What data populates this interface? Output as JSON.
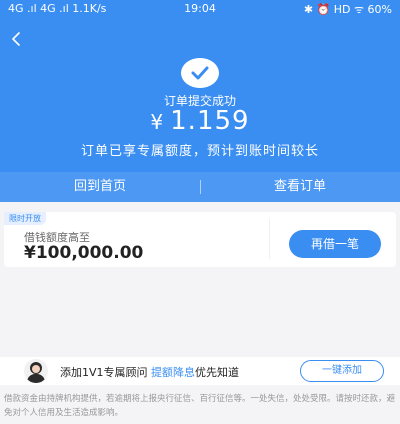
{
  "status_bar": {
    "left": "4G .ıl 4G .ıl 1.1K/s",
    "time": "19:04",
    "right": "✱ ⏰ HD ᯤ 60%"
  },
  "result": {
    "title": "订单提交成功",
    "currency": "¥",
    "amount": "1.159",
    "note": "订单已享专属额度，预计到账时间较长"
  },
  "actions": {
    "home_label": "回到首页",
    "order_label": "查看订单"
  },
  "loan_card": {
    "tag": "限时开放",
    "label": "借钱额度高至",
    "value": "¥100,000.00",
    "button_label": "再借一笔"
  },
  "advisor": {
    "text_before": "添加1V1专属顾问 ",
    "highlight": "提额降息",
    "text_after": "优先知道",
    "button_label": "一键添加"
  },
  "disclaimer": "借款资金由持牌机构提供，若逾期将上报央行征信、百行征信等。一处失信，处处受限。请按时还款，避免对个人信用及生活造成影响。",
  "colors": {
    "accent": "#3a8ef2",
    "hero_background": "#3a8ef2",
    "page_background": "#f4f4f6"
  },
  "icons": [
    "back-arrow-icon",
    "checkmark-icon",
    "signal-icon",
    "wifi-icon",
    "battery-icon",
    "advisor-avatar"
  ]
}
